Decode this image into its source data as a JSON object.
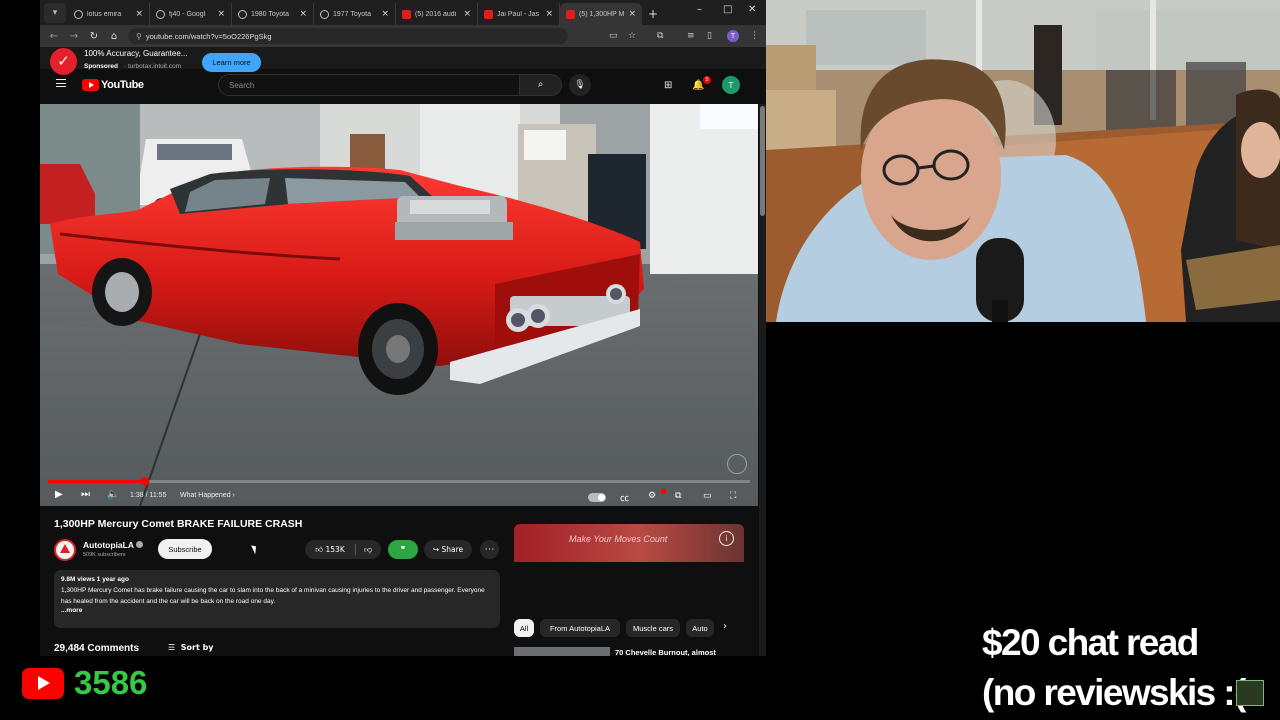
{
  "browser": {
    "tabs": [
      {
        "title": "lotus emira",
        "icon": "google-icon"
      },
      {
        "title": "fj40 - Googl",
        "icon": "google-icon"
      },
      {
        "title": "1980 Toyota",
        "icon": "google-icon"
      },
      {
        "title": "1977 Toyota",
        "icon": "google-icon"
      },
      {
        "title": "(5) 2016 audi",
        "icon": "youtube-icon"
      },
      {
        "title": "Jai Paul - Jas",
        "icon": "youtube-icon"
      },
      {
        "title": "(5) 1,300HP M",
        "icon": "youtube-icon",
        "active": true
      }
    ],
    "url": "youtube.com/watch?v=5oO226PgSkg"
  },
  "youtube": {
    "logo_text": "YouTube",
    "search_placeholder": "Search",
    "notification_count": "5",
    "avatar_letter": "T"
  },
  "player": {
    "time": "1:38 / 11:55",
    "chapter": "What Happened",
    "chapter_arrow": "›",
    "progress_fraction": 0.137
  },
  "video": {
    "title": "1,300HP Mercury Comet BRAKE FAILURE CRASH",
    "channel": "AutotopiaLA",
    "subscribers": "509K subscribers",
    "subscribe_label": "Subscribe",
    "likes": "153K",
    "share_label": "Share",
    "description_meta": "9.8M views  1 year ago",
    "description": "1,300HP Mercury Comet has brake failure causing the car to slam into the back of a minivan causing injuries to the driver and passenger. Everyone has healed from the accident and the car will be back on the road one day.",
    "more_label": "...more",
    "comments_count": "29,484 Comments",
    "sort_label": "Sort by"
  },
  "ad": {
    "banner_text": "Make Your Moves Count",
    "headline": "100% Accuracy, Guarantee...",
    "sponsored": "Sponsored",
    "domain": "· turbotax.intuit.com",
    "cta": "Learn more",
    "info": "i"
  },
  "chips": [
    "All",
    "From AutotopiaLA",
    "Muscle cars",
    "Auto"
  ],
  "recommendation": {
    "title": "70 Chevelle Burnout, almost"
  },
  "stream": {
    "viewer_count": "3586",
    "overlay_line1": "$20 chat read",
    "overlay_line2": "(no reviewskis :(",
    "accent_green": "#37c847",
    "youtube_red": "#ff0000"
  }
}
